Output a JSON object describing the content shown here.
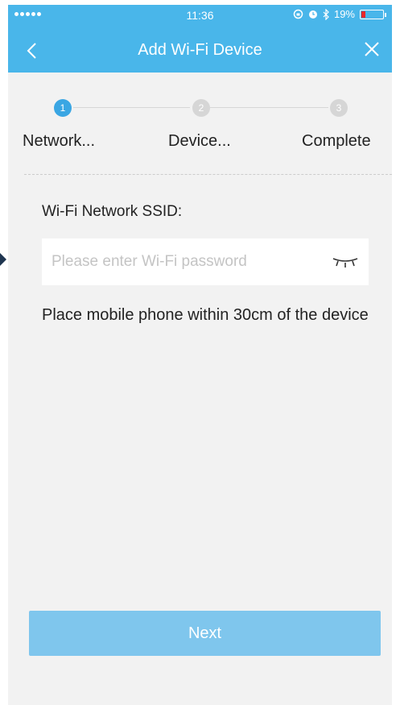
{
  "status_bar": {
    "time": "11:36",
    "battery_percent": "19%",
    "battery_level": 0.19
  },
  "nav": {
    "title": "Add Wi-Fi Device",
    "back_icon": "chevron-left-icon",
    "close_icon": "close-icon"
  },
  "steps": [
    {
      "number": "1",
      "label": "Network...",
      "active": true
    },
    {
      "number": "2",
      "label": "Device...",
      "active": false
    },
    {
      "number": "3",
      "label": "Complete",
      "active": false
    }
  ],
  "form": {
    "ssid_label": "Wi-Fi Network SSID:",
    "password_placeholder": "Please enter Wi-Fi password",
    "password_value": "",
    "eye_icon": "eye-closed-icon"
  },
  "hint": "Place mobile phone within 30cm of the device",
  "next_label": "Next",
  "colors": {
    "header": "#49b6ea",
    "active_step": "#3aa6e3",
    "inactive_step": "#d6d6d6",
    "button": "#7fc6ed",
    "background": "#f2f2f2"
  }
}
